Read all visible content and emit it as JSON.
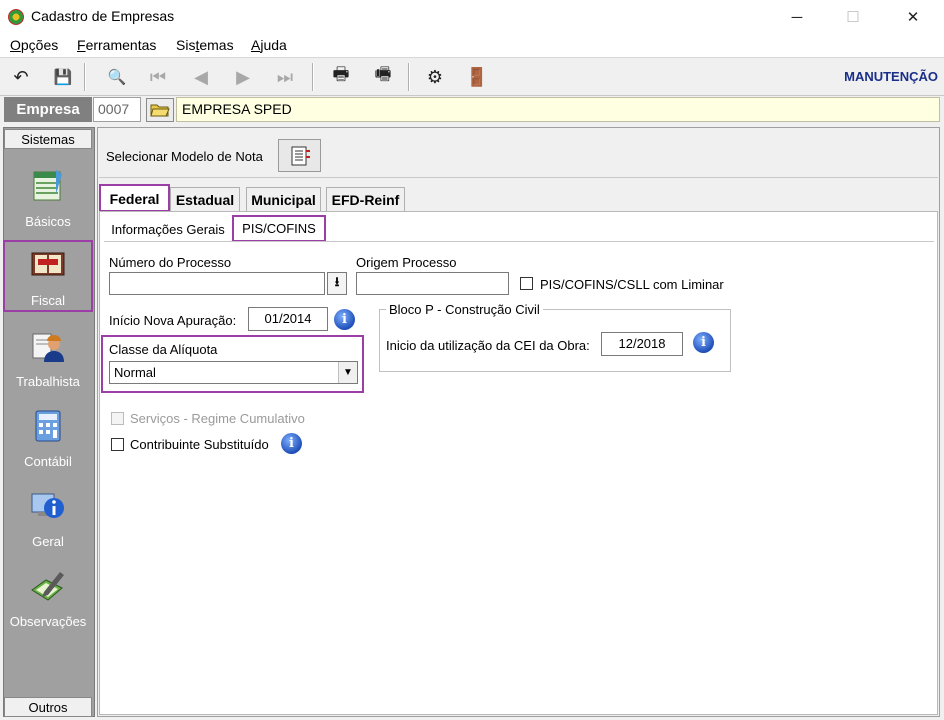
{
  "window": {
    "title": "Cadastro de Empresas",
    "minimize": "─",
    "maximize": "☐",
    "close": "✕"
  },
  "menu": [
    {
      "pre": "",
      "u": "O",
      "post": "pções"
    },
    {
      "pre": "",
      "u": "F",
      "post": "erramentas"
    },
    {
      "pre": "Sis",
      "u": "t",
      "post": "emas"
    },
    {
      "pre": "",
      "u": "A",
      "post": "juda"
    }
  ],
  "toolbar": {
    "undo": "↶",
    "save": "💾",
    "preview": "🔍",
    "first": "⏮",
    "prev": "◀",
    "next": "▶",
    "last": "⏭",
    "print": "🖶",
    "print2": "🖷",
    "config": "⚙",
    "exit": "🚪",
    "mode": "MANUTENÇÃO"
  },
  "empresa": {
    "label": "Empresa",
    "code": "0007",
    "name": "EMPRESA SPED"
  },
  "sidebar": {
    "header": "Sistemas",
    "footer": "Outros",
    "items": [
      {
        "label": "Básicos",
        "icon": "spreadsheet-icon"
      },
      {
        "label": "Fiscal",
        "icon": "book-icon"
      },
      {
        "label": "Trabalhista",
        "icon": "worker-icon"
      },
      {
        "label": "Contábil",
        "icon": "calculator-icon"
      },
      {
        "label": "Geral",
        "icon": "info-monitor-icon"
      },
      {
        "label": "Observações",
        "icon": "pen-note-icon"
      }
    ]
  },
  "modelo": {
    "label": "Selecionar Modelo de Nota"
  },
  "tabs": [
    "Federal",
    "Estadual",
    "Municipal",
    "EFD-Reinf"
  ],
  "subtabs": [
    "Informações Gerais",
    "PIS/COFINS"
  ],
  "form": {
    "numero_processo_label": "Número do Processo",
    "numero_processo_value": "",
    "origem_processo_label": "Origem Processo",
    "origem_processo_value": "",
    "liminar_label": "PIS/COFINS/CSLL com Liminar",
    "inicio_apuracao_label": "Início Nova Apuração:",
    "inicio_apuracao_value": "01/2014",
    "bloco_p_title": "Bloco P - Construção Civil",
    "cei_label": "Inicio da utilização da CEI da Obra:",
    "cei_value": "12/2018",
    "classe_label": "Classe da Alíquota",
    "classe_value": "Normal",
    "servicos_label": "Serviços - Regime Cumulativo",
    "contribuinte_label": "Contribuinte Substituído"
  },
  "colors": {
    "highlight": "#9b3fa6",
    "mode_text": "#1a2f8a",
    "empresa_bg": "#ffffe1"
  }
}
